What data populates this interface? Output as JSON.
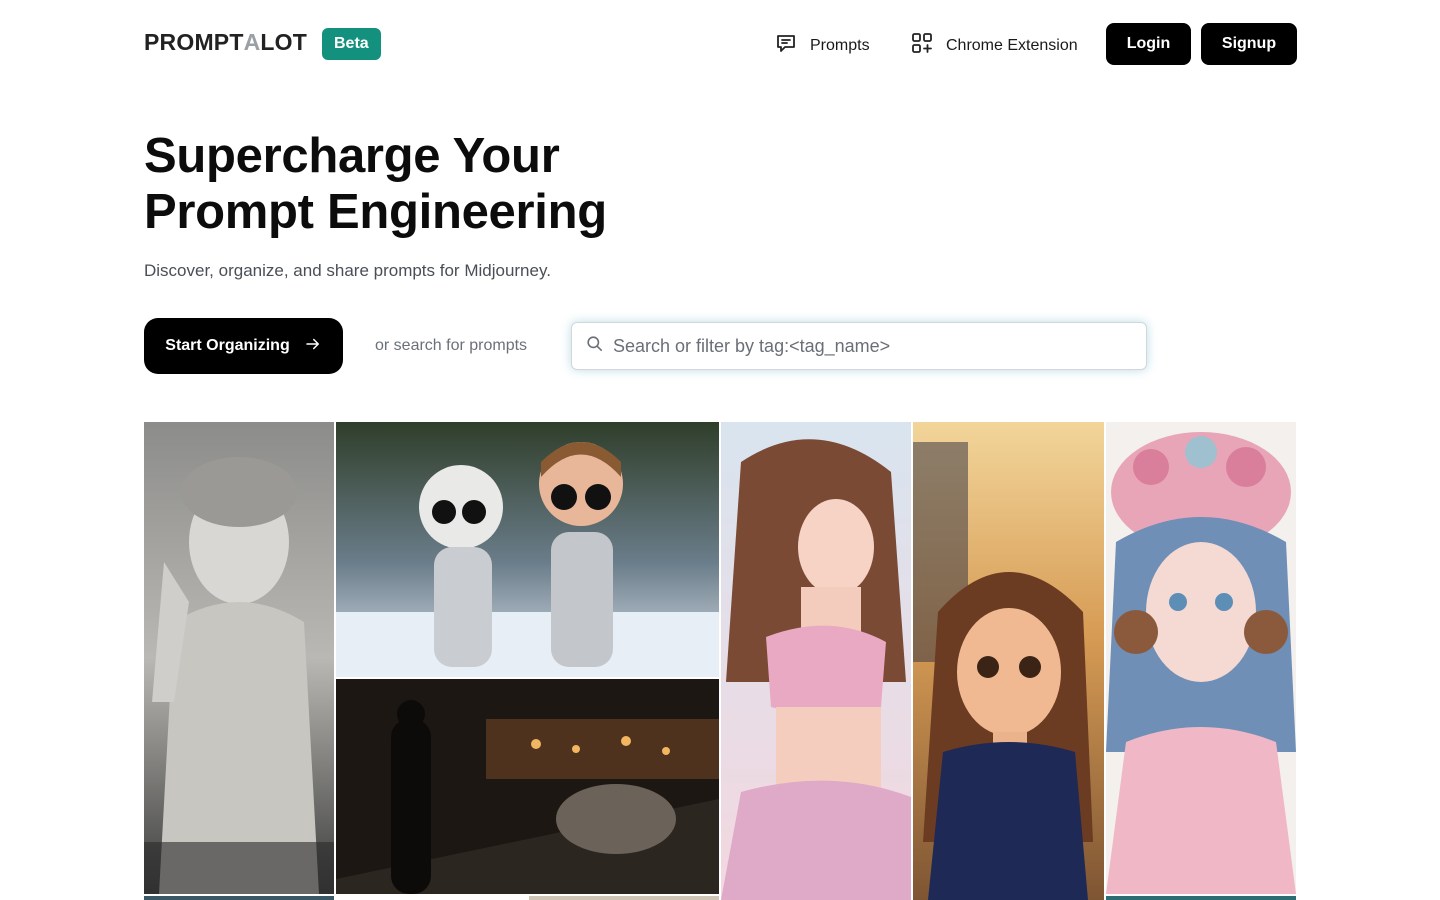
{
  "header": {
    "logo_part1": "PROMPT",
    "logo_part2": "A",
    "logo_part3": "LOT",
    "beta_badge": "Beta",
    "nav_prompts": "Prompts",
    "nav_chrome_extension": "Chrome Extension",
    "login_label": "Login",
    "signup_label": "Signup"
  },
  "hero": {
    "title_line1": "Supercharge Your",
    "title_line2": "Prompt Engineering",
    "subtitle": "Discover, organize, and share prompts for Midjourney.",
    "start_button": "Start Organizing",
    "or_search": "or search for prompts",
    "search_placeholder": "Search or filter by tag:<tag_name>"
  },
  "colors": {
    "accent_teal": "#14917e",
    "button_dark": "#000000",
    "subtitle_gray": "#4a4f57"
  },
  "gallery": [
    {
      "name": "statue-image",
      "icon": "image"
    },
    {
      "name": "astronaut-toys-image",
      "icon": "image"
    },
    {
      "name": "night-market-image",
      "icon": "image"
    },
    {
      "name": "anime-girl-floral-image",
      "icon": "image"
    },
    {
      "name": "cartoon-girl-image",
      "icon": "image"
    },
    {
      "name": "steampunk-doll-image",
      "icon": "image"
    }
  ]
}
